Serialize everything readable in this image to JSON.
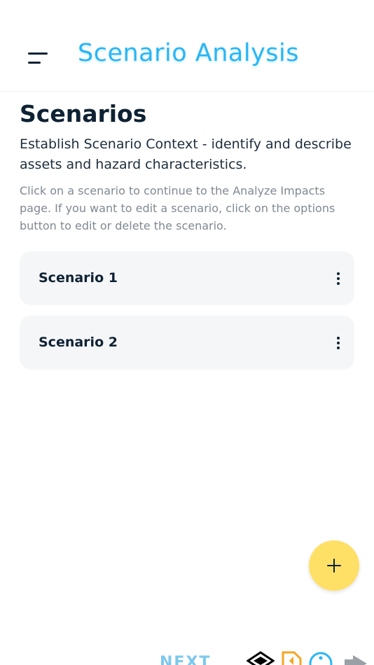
{
  "header": {
    "title": "Scenario Analysis"
  },
  "main": {
    "title": "Scenarios",
    "subtitle": "Establish Scenario Context - identify and describe assets and hazard characteristics.",
    "help": "Click on a scenario to continue to the Analyze Impacts page. If you want to edit a scenario, click on the options button to edit or delete the scenario.",
    "scenarios": [
      {
        "name": "Scenario 1"
      },
      {
        "name": "Scenario 2"
      }
    ]
  },
  "footer": {
    "next_label": "NEXT",
    "icons": [
      "layers-icon",
      "document-icon",
      "info-icon",
      "arrow-icon"
    ]
  },
  "colors": {
    "accent": "#29b6f6",
    "fab": "#ffe066",
    "card": "#f5f6f8",
    "text": "#0e2233"
  }
}
